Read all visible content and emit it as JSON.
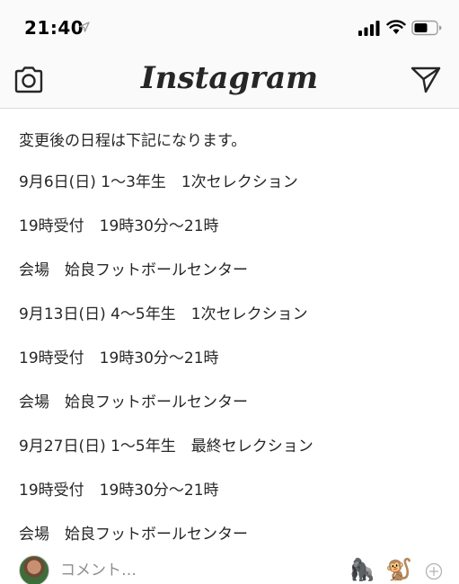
{
  "status_bar": {
    "time": "21:40",
    "icons": [
      "location-arrow-icon",
      "cellular-signal-icon",
      "wifi-icon",
      "battery-icon"
    ]
  },
  "nav": {
    "title": "Instagram",
    "left_icon": "camera-icon",
    "right_icon": "direct-message-icon"
  },
  "content": {
    "lines": [
      "変更後の日程は下記になります。",
      "9月6日(日) 1〜3年生　1次セレクション",
      "19時受付　19時30分〜21時",
      "会場　姶良フットボールセンター",
      "9月13日(日) 4〜5年生　1次セレクション",
      "19時受付　19時30分〜21時",
      "会場　姶良フットボールセンター",
      "9月27日(日) 1〜5年生　最終セレクション",
      "19時受付　19時30分〜21時",
      "会場　姶良フットボールセンター"
    ]
  },
  "comment_bar": {
    "placeholder": "コメント…",
    "quick_emojis": [
      "🦍",
      "🐒"
    ],
    "add_icon": "add-circle-icon"
  },
  "colors": {
    "text": "#262626",
    "bar_background": "#fafafa",
    "divider": "#dbdbdb",
    "placeholder": "#8e8e8e"
  }
}
